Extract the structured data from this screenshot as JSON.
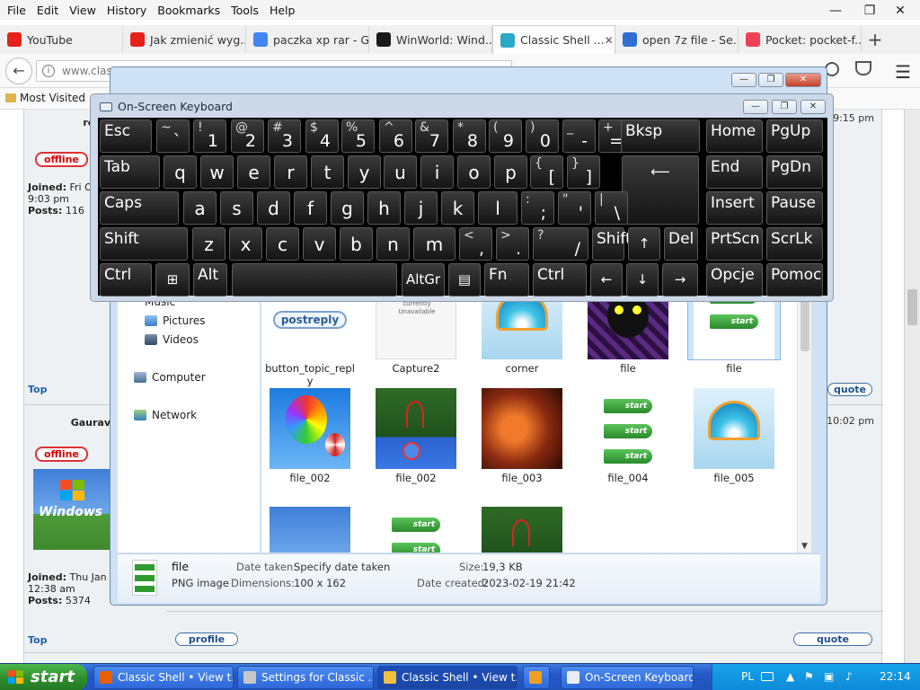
{
  "firefox": {
    "menu": [
      "File",
      "Edit",
      "View",
      "History",
      "Bookmarks",
      "Tools",
      "Help"
    ],
    "window_controls": {
      "minimize": "—",
      "restore": "❐",
      "close": "✕"
    },
    "tabs": [
      {
        "label": "YouTube",
        "favicon": "youtube-icon",
        "color": "#e62117"
      },
      {
        "label": "Jak zmienić wyg...",
        "favicon": "youtube-icon",
        "color": "#e62117"
      },
      {
        "label": "paczka xp rar - G...",
        "favicon": "google-icon",
        "color": "#4285f4"
      },
      {
        "label": "WinWorld: Wind...",
        "favicon": "winworld-icon",
        "color": "#1a1a1a"
      },
      {
        "label": "Classic Shell ...",
        "favicon": "classic-shell-icon",
        "color": "#2aa8c8",
        "active": true
      },
      {
        "label": "open 7z file - Se...",
        "favicon": "search-icon",
        "color": "#2f6fd4"
      },
      {
        "label": "Pocket: pocket-f...",
        "favicon": "pocket-icon",
        "color": "#ef4056"
      }
    ],
    "new_tab": "+",
    "url": "www.class",
    "back": "←",
    "bookmarks": {
      "most_visited": "Most Visited"
    }
  },
  "forum": {
    "post1": {
      "user": "redb",
      "status": "offline",
      "joined_label": "Joined:",
      "joined": "Fri O",
      "joined_time": "9:03 pm",
      "posts_label": "Posts:",
      "posts": "116",
      "time": "9:15 pm"
    },
    "post2": {
      "user": "Gaurav",
      "status": "offline",
      "joined_label": "Joined:",
      "joined": "Thu Jan",
      "joined_time": "12:38 am",
      "posts_label": "Posts:",
      "posts": "5374",
      "time": "10:02 pm",
      "avatar_text": "Windows"
    },
    "top_link": "Top",
    "quote_label": "quote",
    "profile_label": "profile"
  },
  "explorer": {
    "nav": {
      "music": "Music",
      "pictures": "Pictures",
      "videos": "Videos",
      "computer": "Computer",
      "network": "Network"
    },
    "files": [
      {
        "name": "button_topic_reply",
        "thumb": "postreply"
      },
      {
        "name": "Capture2",
        "thumb": "capture"
      },
      {
        "name": "corner",
        "thumb": "shell"
      },
      {
        "name": "file",
        "thumb": "monster"
      },
      {
        "name": "file",
        "thumb": "start-buttons",
        "selected": true
      },
      {
        "name": "file_002",
        "thumb": "balloons"
      },
      {
        "name": "file_002",
        "thumb": "taskbar"
      },
      {
        "name": "file_003",
        "thumb": "lava"
      },
      {
        "name": "file_004",
        "thumb": "start-buttons3"
      },
      {
        "name": "file_005",
        "thumb": "shell"
      },
      {
        "name": "",
        "thumb": "winxp"
      },
      {
        "name": "",
        "thumb": "start-buttons"
      },
      {
        "name": "",
        "thumb": "taskbar"
      }
    ],
    "postreply_text": "postreply",
    "start_text": "start",
    "capture_text": "Sorry. This image is currently Unavailable",
    "details": {
      "name": "file",
      "type": "PNG image",
      "date_taken_label": "Date taken:",
      "date_taken": "Specify date taken",
      "dimensions_label": "Dimensions:",
      "dimensions": "100 x 162",
      "size_label": "Size:",
      "size": "19,3 KB",
      "date_created_label": "Date created:",
      "date_created": "2023-02-19 21:42"
    }
  },
  "osk": {
    "title": "On-Screen Keyboard",
    "row1": [
      {
        "label": "Esc"
      },
      {
        "shift": "~",
        "main": "`"
      },
      {
        "shift": "!",
        "main": "1"
      },
      {
        "shift": "@",
        "main": "2"
      },
      {
        "shift": "#",
        "main": "3"
      },
      {
        "shift": "$",
        "main": "4"
      },
      {
        "shift": "%",
        "main": "5"
      },
      {
        "shift": "^",
        "main": "6"
      },
      {
        "shift": "&",
        "main": "7"
      },
      {
        "shift": "*",
        "main": "8"
      },
      {
        "shift": "(",
        "main": "9"
      },
      {
        "shift": ")",
        "main": "0"
      },
      {
        "shift": "_",
        "main": "-"
      },
      {
        "shift": "+",
        "main": "="
      },
      {
        "label": "Bksp"
      },
      {
        "label": "Home"
      },
      {
        "label": "PgUp"
      }
    ],
    "row2": [
      {
        "label": "Tab"
      },
      {
        "letter": "q"
      },
      {
        "letter": "w"
      },
      {
        "letter": "e"
      },
      {
        "letter": "r"
      },
      {
        "letter": "t"
      },
      {
        "letter": "y"
      },
      {
        "letter": "u"
      },
      {
        "letter": "i"
      },
      {
        "letter": "o"
      },
      {
        "letter": "p"
      },
      {
        "shift": "{",
        "main": "["
      },
      {
        "shift": "}",
        "main": "]"
      },
      {
        "label": "⟵"
      },
      {
        "label": "End"
      },
      {
        "label": "PgDn"
      }
    ],
    "row3": [
      {
        "label": "Caps"
      },
      {
        "letter": "a"
      },
      {
        "letter": "s"
      },
      {
        "letter": "d"
      },
      {
        "letter": "f"
      },
      {
        "letter": "g"
      },
      {
        "letter": "h"
      },
      {
        "letter": "j"
      },
      {
        "letter": "k"
      },
      {
        "letter": "l"
      },
      {
        "shift": ":",
        "main": ";"
      },
      {
        "shift": "\"",
        "main": "'"
      },
      {
        "shift": "|",
        "main": "\\"
      },
      {
        "label": "Insert"
      },
      {
        "label": "Pause"
      }
    ],
    "row4": [
      {
        "label": "Shift"
      },
      {
        "letter": "z"
      },
      {
        "letter": "x"
      },
      {
        "letter": "c"
      },
      {
        "letter": "v"
      },
      {
        "letter": "b"
      },
      {
        "letter": "n"
      },
      {
        "letter": "m"
      },
      {
        "shift": "<",
        "main": ","
      },
      {
        "shift": ">",
        "main": "."
      },
      {
        "shift": "?",
        "main": "/"
      },
      {
        "label": "Shift"
      },
      {
        "label": "↑"
      },
      {
        "label": "Del"
      },
      {
        "label": "PrtScn"
      },
      {
        "label": "ScrLk"
      }
    ],
    "row5": [
      {
        "label": "Ctrl"
      },
      {
        "label": "⊞"
      },
      {
        "label": "Alt"
      },
      {
        "label": ""
      },
      {
        "label": "AltGr"
      },
      {
        "label": "▤"
      },
      {
        "label": "Fn"
      },
      {
        "label": "Ctrl"
      },
      {
        "label": "←"
      },
      {
        "label": "↓"
      },
      {
        "label": "→"
      },
      {
        "label": "Opcje"
      },
      {
        "label": "Pomoc"
      }
    ]
  },
  "taskbar": {
    "start": "start",
    "items": [
      {
        "label": "Classic Shell • View t...",
        "icon": "firefox-icon"
      },
      {
        "label": "Settings for Classic ...",
        "icon": "settings-icon"
      },
      {
        "label": "Classic Shell • View t...",
        "icon": "folder-icon",
        "active": true
      },
      {
        "label": "",
        "icon": "media-icon"
      },
      {
        "label": "On-Screen Keyboard",
        "icon": "keyboard-icon"
      }
    ],
    "tray": {
      "lang": "PL",
      "time": "22:14"
    }
  }
}
